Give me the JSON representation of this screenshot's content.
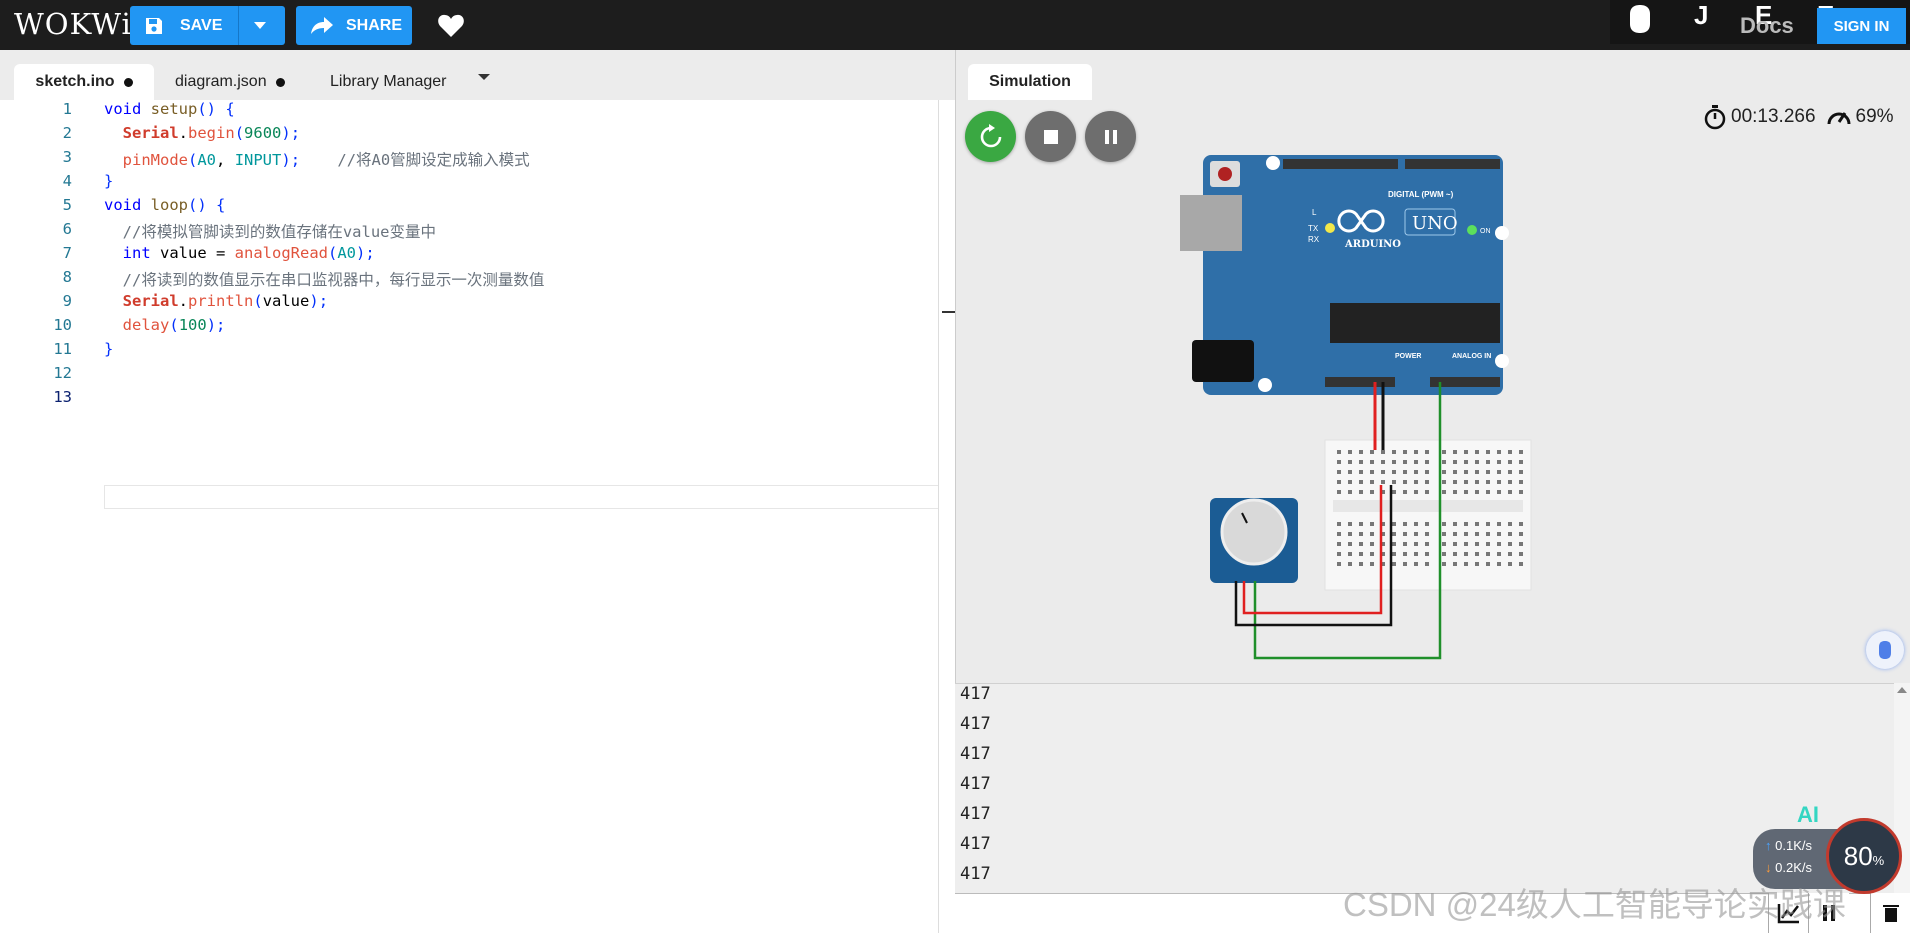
{
  "header": {
    "logo": "WOKWi",
    "save_label": "SAVE",
    "share_label": "SHARE",
    "right_glyphs": [
      "J",
      "E",
      "E"
    ],
    "docs_label": "Docs",
    "signin_label": "SIGN IN"
  },
  "editor": {
    "tabs": [
      {
        "label": "sketch.ino",
        "active": true,
        "modified": true
      },
      {
        "label": "diagram.json",
        "active": false,
        "modified": true
      },
      {
        "label": "Library Manager",
        "active": false,
        "modified": false
      }
    ],
    "line_numbers": [
      "1",
      "2",
      "3",
      "4",
      "5",
      "6",
      "7",
      "8",
      "9",
      "10",
      "11",
      "12",
      "13"
    ],
    "lines": [
      "void setup() {",
      "  Serial.begin(9600);",
      "  pinMode(A0, INPUT);    //将A0管脚设定成输入模式",
      "}",
      "void loop() {",
      "  //将模拟管脚读到的数值存储在value变量中",
      "  int value = analogRead(A0);",
      "  //将读到的数值显示在串口监视器中，每行显示一次测量数值",
      "  Serial.println(value);",
      "  delay(100);",
      "}",
      "",
      ""
    ]
  },
  "simulation": {
    "tab_label": "Simulation",
    "timer": "00:13.266",
    "speed": "69%",
    "board": {
      "model_label": "UNO",
      "brand_label": "ARDUINO",
      "digital_header": "DIGITAL (PWM ~)",
      "power_header": "POWER",
      "analog_header": "ANALOG IN",
      "led_labels": [
        "L",
        "TX",
        "RX",
        "ON"
      ]
    }
  },
  "serial_monitor": {
    "lines": [
      "417",
      "417",
      "417",
      "417",
      "417",
      "417",
      "417"
    ]
  },
  "overlay": {
    "ai_label": "AI",
    "upload_rate": "0.1K/s",
    "download_rate": "0.2K/s",
    "gauge_value": "80",
    "gauge_unit": "%",
    "watermark": "CSDN @24级人工智能导论实践课"
  },
  "colors": {
    "accent": "#2196f3",
    "board_blue": "#2f6fa8",
    "wire_red": "#e02020",
    "wire_green": "#1f8f2a",
    "wire_black": "#111111",
    "restart_green": "#3aa842"
  }
}
